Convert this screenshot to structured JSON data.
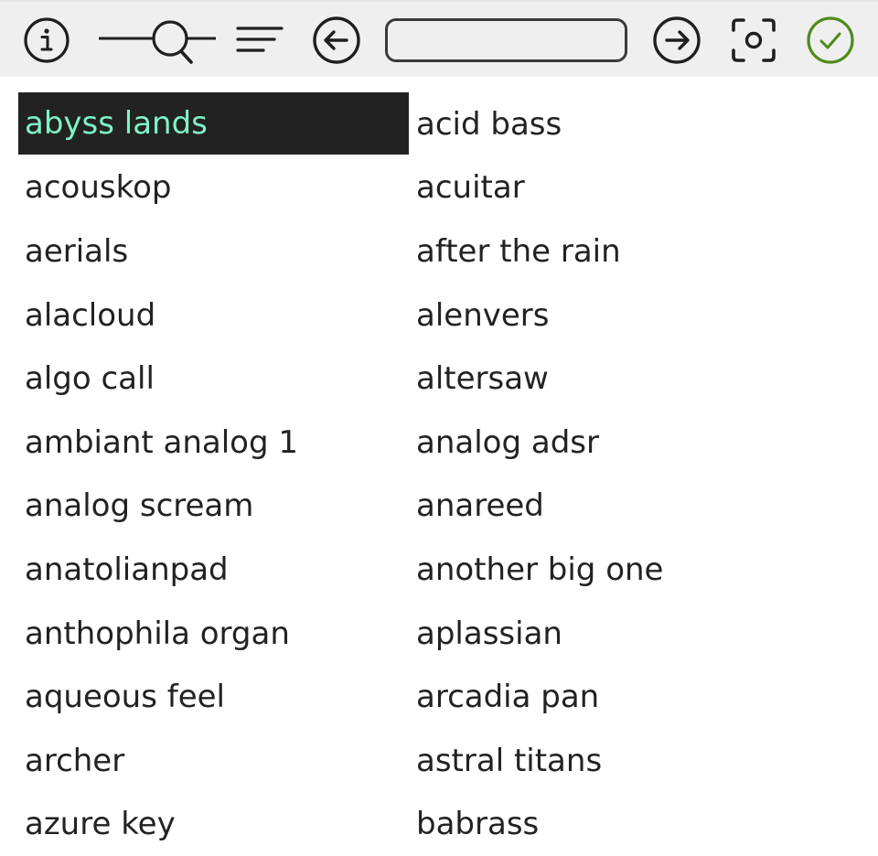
{
  "toolbar": {
    "search_value": "",
    "search_placeholder": "",
    "icons": [
      "info-icon",
      "magnifier-icon",
      "filter-lines-icon",
      "arrow-left-icon",
      "arrow-right-icon",
      "capture-icon",
      "confirm-check-icon"
    ],
    "colors": {
      "background": "#efefef",
      "icon": "#1f1f1f",
      "confirm": "#4f8a1a"
    }
  },
  "list": {
    "selected_index": 0,
    "selected_bg": "#222222",
    "selected_fg": "#7ff3c6",
    "items": [
      "abyss lands",
      "acid bass",
      "acouskop",
      "acuitar",
      "aerials",
      "after the rain",
      "alacloud",
      "alenvers",
      "algo call",
      "altersaw",
      "ambiant analog 1",
      "analog adsr",
      "analog scream",
      "anareed",
      "anatolianpad",
      "another big one",
      "anthophila organ",
      "aplassian",
      "aqueous feel",
      "arcadia pan",
      "archer",
      "astral titans",
      "azure key",
      "babrass"
    ]
  }
}
